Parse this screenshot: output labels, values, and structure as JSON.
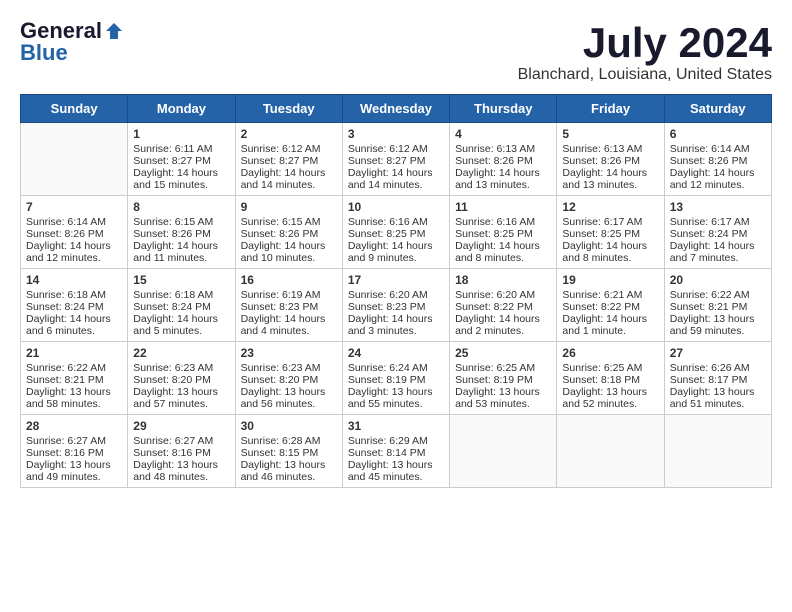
{
  "logo": {
    "general": "General",
    "blue": "Blue"
  },
  "title": "July 2024",
  "subtitle": "Blanchard, Louisiana, United States",
  "days_of_week": [
    "Sunday",
    "Monday",
    "Tuesday",
    "Wednesday",
    "Thursday",
    "Friday",
    "Saturday"
  ],
  "weeks": [
    [
      {
        "day": "",
        "info": ""
      },
      {
        "day": "1",
        "info": "Sunrise: 6:11 AM\nSunset: 8:27 PM\nDaylight: 14 hours\nand 15 minutes."
      },
      {
        "day": "2",
        "info": "Sunrise: 6:12 AM\nSunset: 8:27 PM\nDaylight: 14 hours\nand 14 minutes."
      },
      {
        "day": "3",
        "info": "Sunrise: 6:12 AM\nSunset: 8:27 PM\nDaylight: 14 hours\nand 14 minutes."
      },
      {
        "day": "4",
        "info": "Sunrise: 6:13 AM\nSunset: 8:26 PM\nDaylight: 14 hours\nand 13 minutes."
      },
      {
        "day": "5",
        "info": "Sunrise: 6:13 AM\nSunset: 8:26 PM\nDaylight: 14 hours\nand 13 minutes."
      },
      {
        "day": "6",
        "info": "Sunrise: 6:14 AM\nSunset: 8:26 PM\nDaylight: 14 hours\nand 12 minutes."
      }
    ],
    [
      {
        "day": "7",
        "info": "Sunrise: 6:14 AM\nSunset: 8:26 PM\nDaylight: 14 hours\nand 12 minutes."
      },
      {
        "day": "8",
        "info": "Sunrise: 6:15 AM\nSunset: 8:26 PM\nDaylight: 14 hours\nand 11 minutes."
      },
      {
        "day": "9",
        "info": "Sunrise: 6:15 AM\nSunset: 8:26 PM\nDaylight: 14 hours\nand 10 minutes."
      },
      {
        "day": "10",
        "info": "Sunrise: 6:16 AM\nSunset: 8:25 PM\nDaylight: 14 hours\nand 9 minutes."
      },
      {
        "day": "11",
        "info": "Sunrise: 6:16 AM\nSunset: 8:25 PM\nDaylight: 14 hours\nand 8 minutes."
      },
      {
        "day": "12",
        "info": "Sunrise: 6:17 AM\nSunset: 8:25 PM\nDaylight: 14 hours\nand 8 minutes."
      },
      {
        "day": "13",
        "info": "Sunrise: 6:17 AM\nSunset: 8:24 PM\nDaylight: 14 hours\nand 7 minutes."
      }
    ],
    [
      {
        "day": "14",
        "info": "Sunrise: 6:18 AM\nSunset: 8:24 PM\nDaylight: 14 hours\nand 6 minutes."
      },
      {
        "day": "15",
        "info": "Sunrise: 6:18 AM\nSunset: 8:24 PM\nDaylight: 14 hours\nand 5 minutes."
      },
      {
        "day": "16",
        "info": "Sunrise: 6:19 AM\nSunset: 8:23 PM\nDaylight: 14 hours\nand 4 minutes."
      },
      {
        "day": "17",
        "info": "Sunrise: 6:20 AM\nSunset: 8:23 PM\nDaylight: 14 hours\nand 3 minutes."
      },
      {
        "day": "18",
        "info": "Sunrise: 6:20 AM\nSunset: 8:22 PM\nDaylight: 14 hours\nand 2 minutes."
      },
      {
        "day": "19",
        "info": "Sunrise: 6:21 AM\nSunset: 8:22 PM\nDaylight: 14 hours\nand 1 minute."
      },
      {
        "day": "20",
        "info": "Sunrise: 6:22 AM\nSunset: 8:21 PM\nDaylight: 13 hours\nand 59 minutes."
      }
    ],
    [
      {
        "day": "21",
        "info": "Sunrise: 6:22 AM\nSunset: 8:21 PM\nDaylight: 13 hours\nand 58 minutes."
      },
      {
        "day": "22",
        "info": "Sunrise: 6:23 AM\nSunset: 8:20 PM\nDaylight: 13 hours\nand 57 minutes."
      },
      {
        "day": "23",
        "info": "Sunrise: 6:23 AM\nSunset: 8:20 PM\nDaylight: 13 hours\nand 56 minutes."
      },
      {
        "day": "24",
        "info": "Sunrise: 6:24 AM\nSunset: 8:19 PM\nDaylight: 13 hours\nand 55 minutes."
      },
      {
        "day": "25",
        "info": "Sunrise: 6:25 AM\nSunset: 8:19 PM\nDaylight: 13 hours\nand 53 minutes."
      },
      {
        "day": "26",
        "info": "Sunrise: 6:25 AM\nSunset: 8:18 PM\nDaylight: 13 hours\nand 52 minutes."
      },
      {
        "day": "27",
        "info": "Sunrise: 6:26 AM\nSunset: 8:17 PM\nDaylight: 13 hours\nand 51 minutes."
      }
    ],
    [
      {
        "day": "28",
        "info": "Sunrise: 6:27 AM\nSunset: 8:16 PM\nDaylight: 13 hours\nand 49 minutes."
      },
      {
        "day": "29",
        "info": "Sunrise: 6:27 AM\nSunset: 8:16 PM\nDaylight: 13 hours\nand 48 minutes."
      },
      {
        "day": "30",
        "info": "Sunrise: 6:28 AM\nSunset: 8:15 PM\nDaylight: 13 hours\nand 46 minutes."
      },
      {
        "day": "31",
        "info": "Sunrise: 6:29 AM\nSunset: 8:14 PM\nDaylight: 13 hours\nand 45 minutes."
      },
      {
        "day": "",
        "info": ""
      },
      {
        "day": "",
        "info": ""
      },
      {
        "day": "",
        "info": ""
      }
    ]
  ]
}
